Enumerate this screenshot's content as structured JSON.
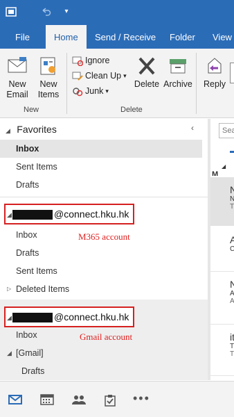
{
  "ribbon_tabs": [
    {
      "label": "File"
    },
    {
      "label": "Home"
    },
    {
      "label": "Send / Receive"
    },
    {
      "label": "Folder"
    },
    {
      "label": "View"
    }
  ],
  "ribbon": {
    "new_email": "New Email",
    "new_items": "New Items",
    "group_new": "New",
    "ignore": "Ignore",
    "clean_up": "Clean Up",
    "junk": "Junk",
    "delete": "Delete",
    "archive": "Archive",
    "group_delete": "Delete",
    "reply": "Reply"
  },
  "favorites": {
    "title": "Favorites",
    "items": [
      "Inbox",
      "Sent Items",
      "Drafts"
    ]
  },
  "accounts": [
    {
      "domain": "@connect.hku.hk",
      "note": "M365 account",
      "folders": [
        "Inbox",
        "Drafts",
        "Sent Items",
        "Deleted Items"
      ]
    },
    {
      "domain": "@connect.hku.hk",
      "note": "Gmail account",
      "folders": [
        "Inbox",
        "[Gmail]",
        "Drafts"
      ]
    }
  ],
  "message_list": {
    "search_placeholder": "Sear",
    "group_header": "M",
    "rows": [
      {
        "a": "N",
        "b": "N",
        "c": "T"
      },
      {
        "a": "A",
        "b": "C"
      },
      {
        "a": "N",
        "b": "A",
        "c": "A"
      },
      {
        "a": "it",
        "b": "T",
        "c": "T"
      },
      {
        "a": "G",
        "b": "Y"
      }
    ]
  },
  "colors": {
    "accent": "#2b6cb7",
    "highlight_box": "#d62020"
  }
}
